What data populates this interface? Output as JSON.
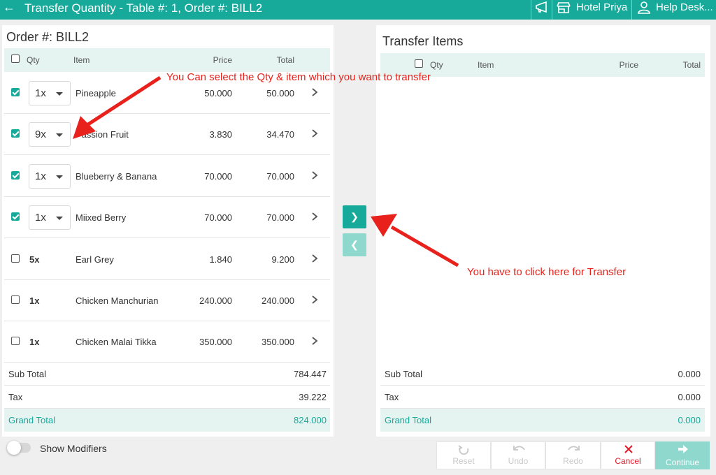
{
  "header": {
    "title": "Transfer Quantity - Table #: 1, Order #: BILL2",
    "hotel": "Hotel Priya",
    "help": "Help Desk..."
  },
  "left": {
    "title": "Order #: BILL2",
    "columns": {
      "qty": "Qty",
      "item": "Item",
      "price": "Price",
      "total": "Total"
    },
    "rows": [
      {
        "qty": "1x",
        "name": "Pineapple",
        "price": "50.000",
        "total": "50.000",
        "checked": true,
        "dropdown": true
      },
      {
        "qty": "9x",
        "name": "Passion Fruit",
        "price": "3.830",
        "total": "34.470",
        "checked": true,
        "dropdown": true
      },
      {
        "qty": "1x",
        "name": "Blueberry & Banana",
        "price": "70.000",
        "total": "70.000",
        "checked": true,
        "dropdown": true
      },
      {
        "qty": "1x",
        "name": "Miixed Berry",
        "price": "70.000",
        "total": "70.000",
        "checked": true,
        "dropdown": true
      },
      {
        "qty": "5x",
        "name": "Earl Grey",
        "price": "1.840",
        "total": "9.200",
        "checked": false,
        "dropdown": false
      },
      {
        "qty": "1x",
        "name": "Chicken Manchurian",
        "price": "240.000",
        "total": "240.000",
        "checked": false,
        "dropdown": false
      },
      {
        "qty": "1x",
        "name": "Chicken Malai Tikka",
        "price": "350.000",
        "total": "350.000",
        "checked": false,
        "dropdown": false
      }
    ],
    "summary": {
      "sub_total_label": "Sub Total",
      "sub_total": "784.447",
      "tax_label": "Tax",
      "tax": "39.222",
      "grand_total_label": "Grand Total",
      "grand_total": "824.000"
    }
  },
  "right": {
    "title": "Transfer Items",
    "columns": {
      "qty": "Qty",
      "item": "Item",
      "price": "Price",
      "total": "Total"
    },
    "summary": {
      "sub_total_label": "Sub Total",
      "sub_total": "0.000",
      "tax_label": "Tax",
      "tax": "0.000",
      "grand_total_label": "Grand Total",
      "grand_total": "0.000"
    }
  },
  "footer": {
    "show_modifiers": "Show Modifiers",
    "reset": "Reset",
    "undo": "Undo",
    "redo": "Redo",
    "cancel": "Cancel",
    "continue": "Continue"
  },
  "annotations": {
    "select_hint": "You Can select the Qty & item which you want to transfer",
    "transfer_hint": "You have to click here for Transfer"
  },
  "colors": {
    "primary": "#17a99a",
    "primary_light": "#8fd8ce",
    "header_bg": "#e5f4f1",
    "cancel": "#e11b2a",
    "annotation": "#e8211c"
  }
}
